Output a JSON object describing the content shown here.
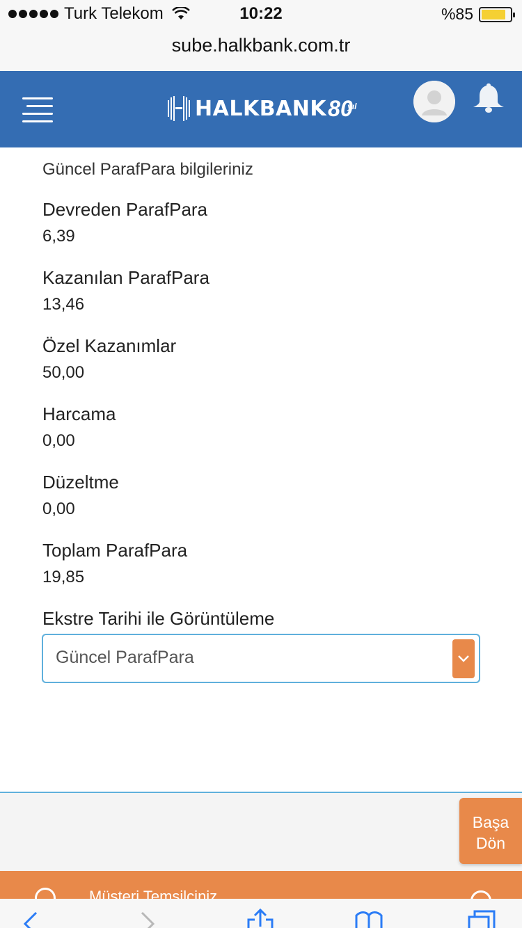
{
  "status_bar": {
    "carrier": "Turk Telekom",
    "time": "10:22",
    "battery_percent": "%85",
    "battery_level": 0.85
  },
  "browser": {
    "url": "sube.halkbank.com.tr"
  },
  "header": {
    "logo_text": "HALKBANK",
    "logo_anniversary": "80",
    "logo_anniversary_suffix": "yıl",
    "brand_color": "#346db3"
  },
  "main": {
    "section_title": "Güncel ParafPara bilgileriniz",
    "fields": [
      {
        "label": "Devreden ParafPara",
        "value": "6,39"
      },
      {
        "label": "Kazanılan ParafPara",
        "value": "13,46"
      },
      {
        "label": "Özel Kazanımlar",
        "value": "50,00"
      },
      {
        "label": "Harcama",
        "value": "0,00"
      },
      {
        "label": "Düzeltme",
        "value": "0,00"
      },
      {
        "label": "Toplam ParafPara",
        "value": "19,85"
      }
    ],
    "statement_select": {
      "label": "Ekstre Tarihi ile Görüntüleme",
      "selected": "Güncel ParafPara"
    }
  },
  "footer": {
    "back_to_top_line1": "Başa",
    "back_to_top_line2": "Dön",
    "representative_text": "Müşteri Temsilciniz",
    "accent_color": "#e8894a"
  },
  "toolbar": {
    "icons": [
      "back-icon",
      "forward-icon",
      "share-icon",
      "bookmarks-icon",
      "tabs-icon"
    ]
  }
}
